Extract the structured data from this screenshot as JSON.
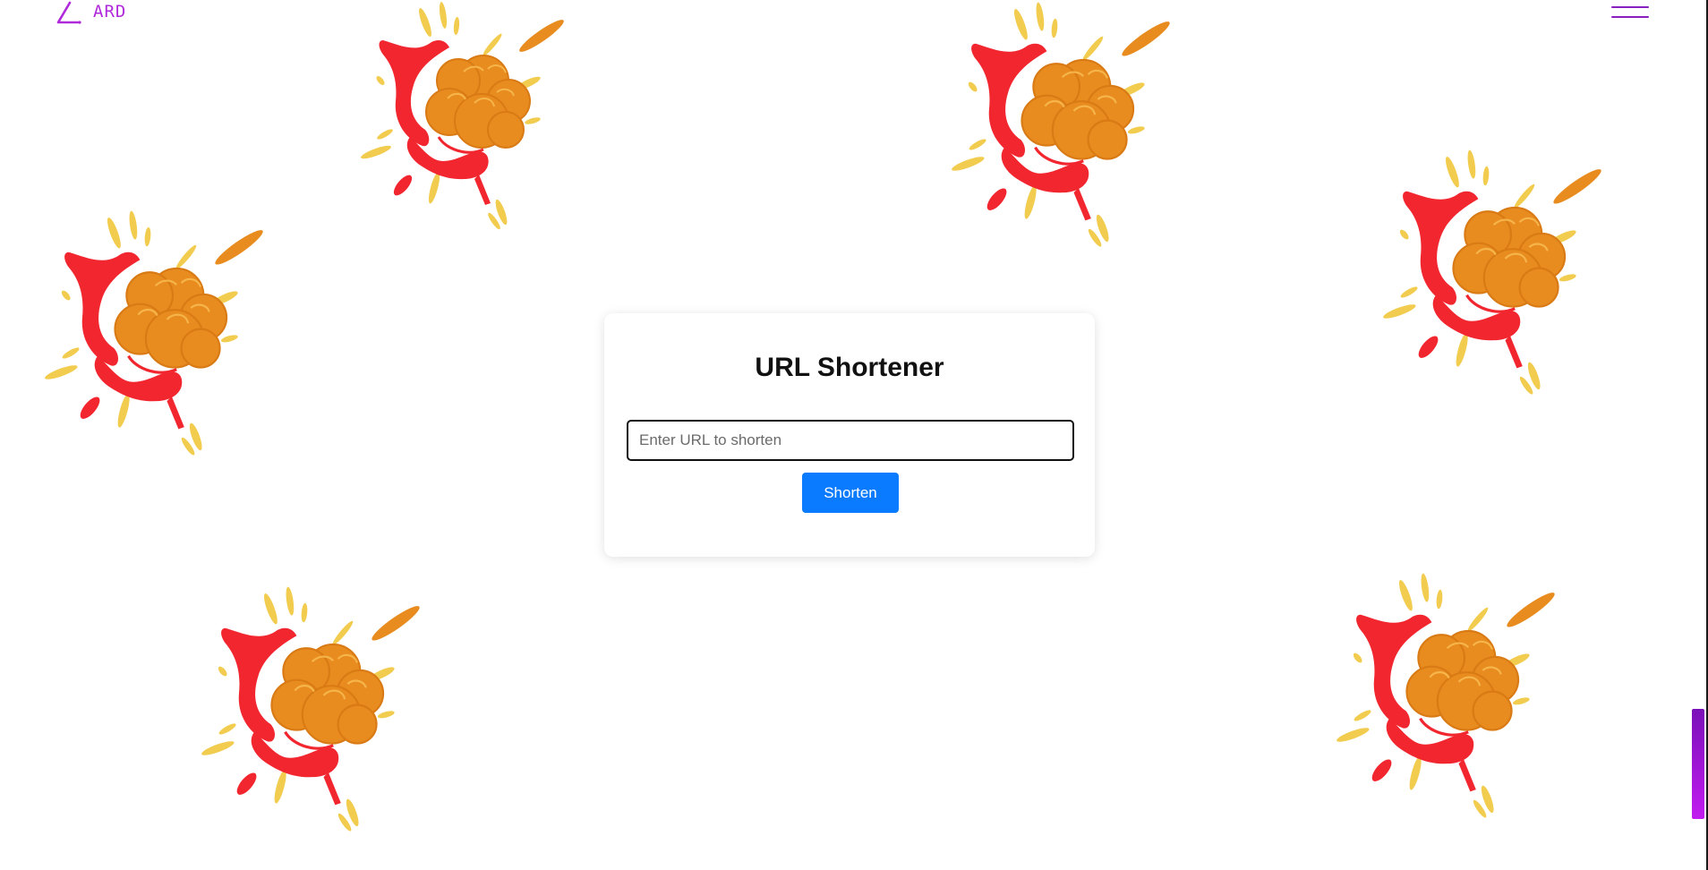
{
  "header": {
    "logo_text": "ARD",
    "logo_icon": "triangle-logo-icon",
    "menu_icon": "hamburger-menu-icon"
  },
  "main": {
    "title": "URL Shortener",
    "url_input": {
      "value": "",
      "placeholder": "Enter URL to shorten"
    },
    "shorten_label": "Shorten"
  },
  "decorations": {
    "explosion_icon": "explosion-icon"
  },
  "colors": {
    "accent_purple": "#b02adb",
    "button_blue": "#0a7bff",
    "explosion_red": "#f2262f",
    "explosion_orange": "#e88c1f",
    "explosion_yellow": "#f2cc4f",
    "scrollbar_top": "#7a10b8",
    "scrollbar_bottom": "#c21cf0"
  }
}
